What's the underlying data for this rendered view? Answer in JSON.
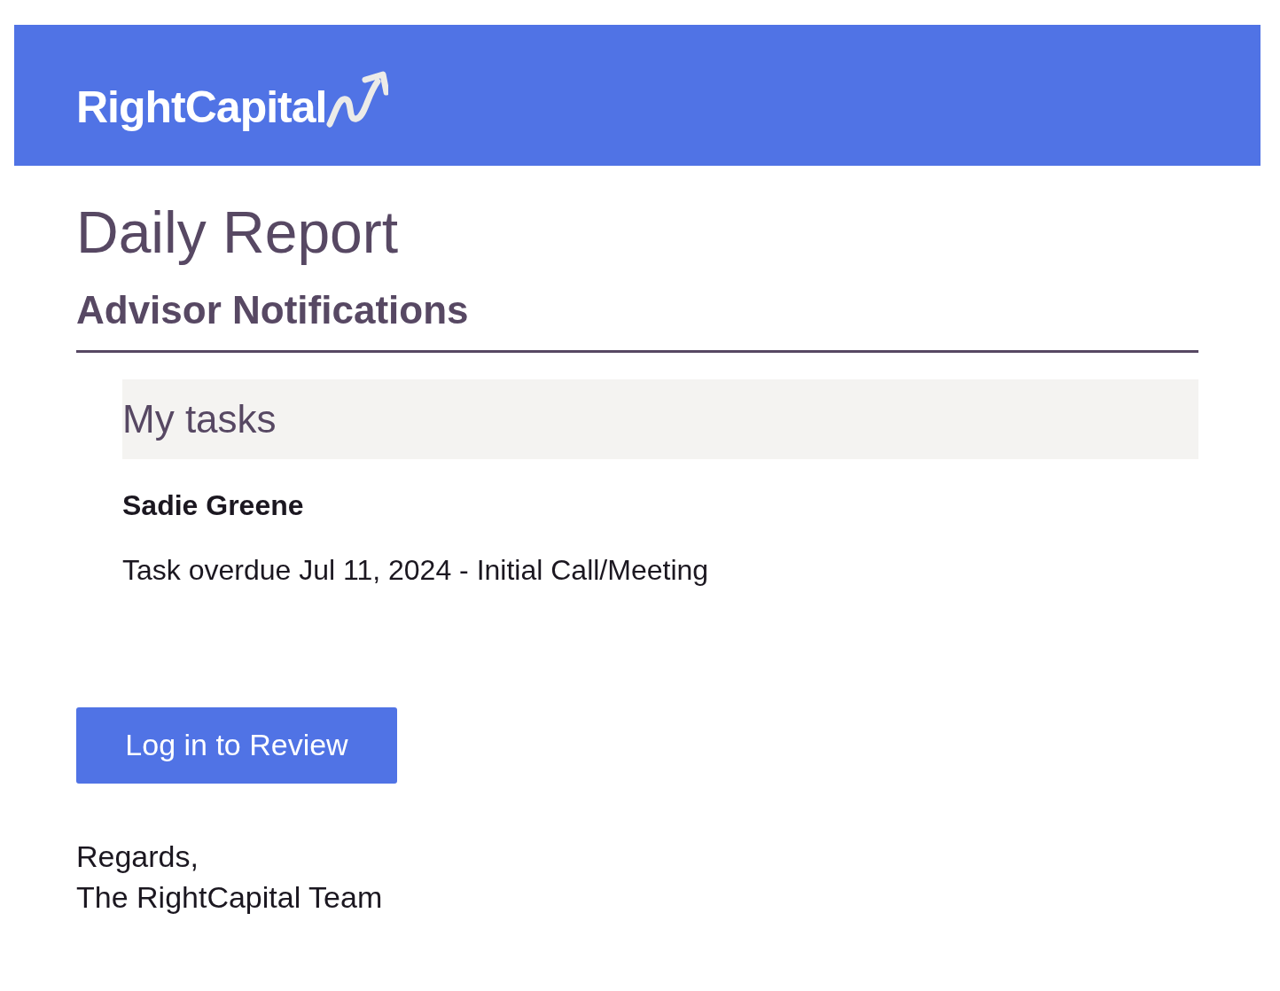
{
  "header": {
    "logo_text": "RightCapital"
  },
  "title": "Daily Report",
  "section_title": "Advisor Notifications",
  "tasks_panel": {
    "title": "My tasks",
    "clients": [
      {
        "name": "Sadie Greene",
        "tasks": [
          "Task overdue Jul 11, 2024 - Initial Call/Meeting"
        ]
      }
    ]
  },
  "button": "Log in to Review",
  "signoff": [
    "Regards,",
    "The RightCapital Team"
  ]
}
